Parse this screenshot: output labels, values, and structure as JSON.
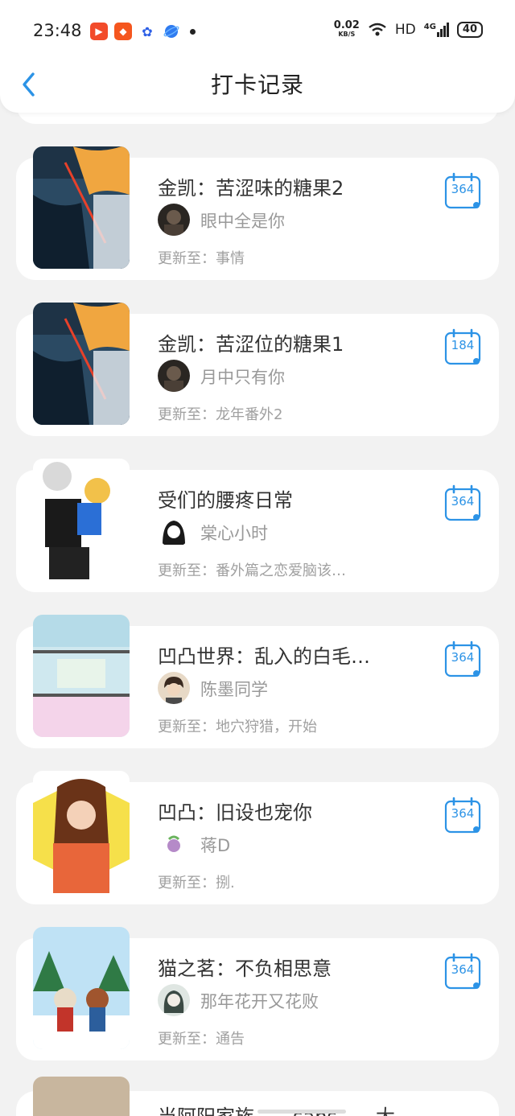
{
  "status_bar": {
    "time": "23:48",
    "net_speed_value": "0.02",
    "net_speed_unit": "KB/S",
    "hd": "HD",
    "signal": "4G",
    "battery": "40"
  },
  "header": {
    "title": "打卡记录"
  },
  "checkins": [
    {
      "title": "金凯：苦涩味的糖果2",
      "author": "眼中全是你",
      "update": "更新至：事情",
      "days": "364"
    },
    {
      "title": "金凯：苦涩位的糖果1",
      "author": "月中只有你",
      "update": "更新至：龙年番外2",
      "days": "184"
    },
    {
      "title": "受们的腰疼日常",
      "author": "棠心小时",
      "update": "更新至：番外篇之恋爱脑该…",
      "days": "364"
    },
    {
      "title": "凹凸世界：乱入的白毛…",
      "author": "陈墨同学",
      "update": "更新至：地穴狩猎，开始",
      "days": "364"
    },
    {
      "title": "凹凸：旧设也宠你",
      "author": "蒋D",
      "update": "更新至：捌.",
      "days": "364"
    },
    {
      "title": "猫之茗：不负相思意",
      "author": "那年花开又花败",
      "update": "更新至：通告",
      "days": "364"
    }
  ],
  "partial_item": {
    "title": "当阿阳家族……sans……大"
  },
  "colors": {
    "accent": "#2c93e6",
    "background": "#f2f2f2",
    "card": "#ffffff"
  }
}
